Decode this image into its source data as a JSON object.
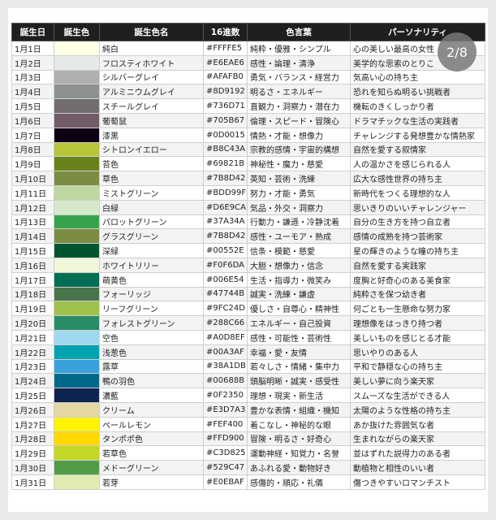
{
  "headers": [
    "誕生日",
    "誕生色",
    "誕生色名",
    "16進数",
    "色言葉",
    "パーソナリティ"
  ],
  "page_indicator": "2/8",
  "rows": [
    {
      "date": "1月1日",
      "color": "#FFFFE5",
      "name": "純白",
      "hex": "#FFFFE5",
      "words": "純粋・優雅・シンプル",
      "personality": "心の美しい最高の女性"
    },
    {
      "date": "1月2日",
      "color": "#E6EAE6",
      "name": "フロスティホワイト",
      "hex": "#E6EAE6",
      "words": "感性・論理・清浄",
      "personality": "美学的な思索のとりこ"
    },
    {
      "date": "1月3日",
      "color": "#AFAFB0",
      "name": "シルバーグレイ",
      "hex": "#AFAFB0",
      "words": "勇気・バランス・経営力",
      "personality": "気高い心の持ち主"
    },
    {
      "date": "1月4日",
      "color": "#8D9192",
      "name": "アルミニウムグレイ",
      "hex": "#8D9192",
      "words": "明るさ・エネルギー",
      "personality": "恐れを知らぬ明るい挑戦者"
    },
    {
      "date": "1月5日",
      "color": "#736D71",
      "name": "スチールグレイ",
      "hex": "#736D71",
      "words": "直観力・洞察力・潜在力",
      "personality": "機転のきくしっかり者"
    },
    {
      "date": "1月6日",
      "color": "#705B67",
      "name": "葡萄鼠",
      "hex": "#705B67",
      "words": "倫理・スピード・冒険心",
      "personality": "ドラマチックな生活の実践者"
    },
    {
      "date": "1月7日",
      "color": "#0D0015",
      "name": "漆黒",
      "hex": "#0D0015",
      "words": "情熱・才能・想像力",
      "personality": "チャレンジする発想豊かな情熱家"
    },
    {
      "date": "1月8日",
      "color": "#B8C43A",
      "name": "シトロンイエロー",
      "hex": "#B8C43A",
      "words": "宗教的感情・宇宙的構想",
      "personality": "自然を愛する叙情家"
    },
    {
      "date": "1月9日",
      "color": "#69821B",
      "name": "苔色",
      "hex": "#69821B",
      "words": "神秘性・魔力・慈愛",
      "personality": "人の温かさを感じられる人"
    },
    {
      "date": "1月10日",
      "color": "#7B8D42",
      "name": "草色",
      "hex": "#7B8D42",
      "words": "英知・芸術・洗練",
      "personality": "広大な感性世界の持ち主"
    },
    {
      "date": "1月11日",
      "color": "#BDD99F",
      "name": "ミストグリーン",
      "hex": "#BDD99F",
      "words": "努力・才能・勇気",
      "personality": "新時代をつくる理想的な人"
    },
    {
      "date": "1月12日",
      "color": "#D6E9CA",
      "name": "白緑",
      "hex": "#D6E9CA",
      "words": "気品・外交・洞察力",
      "personality": "思いきりのいいチャレンジャー"
    },
    {
      "date": "1月13日",
      "color": "#37A34A",
      "name": "パロットグリーン",
      "hex": "#37A34A",
      "words": "行動力・謙遜・冷静沈着",
      "personality": "自分の生き方を持つ自立者"
    },
    {
      "date": "1月14日",
      "color": "#7B8D42",
      "name": "グラスグリーン",
      "hex": "#7B8D42",
      "words": "感性・ユーモア・熟成",
      "personality": "感情の成熟を持つ芸術家"
    },
    {
      "date": "1月15日",
      "color": "#00552E",
      "name": "深緑",
      "hex": "#00552E",
      "words": "信条・模範・慈愛",
      "personality": "星の輝きのような瞳の持ち主"
    },
    {
      "date": "1月16日",
      "color": "#F0F6DA",
      "name": "ホワイトリリー",
      "hex": "#F0F6DA",
      "words": "大胆・想像力・信念",
      "personality": "自然を愛する実践家"
    },
    {
      "date": "1月17日",
      "color": "#006E54",
      "name": "萌黄色",
      "hex": "#006E54",
      "words": "生活・指導力・微笑み",
      "personality": "度胸と好奇心のある美食家"
    },
    {
      "date": "1月18日",
      "color": "#47744B",
      "name": "フォーリッジ",
      "hex": "#47744B",
      "words": "誠実・洗練・謙虚",
      "personality": "純粋さを保つ幼き者"
    },
    {
      "date": "1月19日",
      "color": "#9FC24D",
      "name": "リーフグリーン",
      "hex": "#9FC24D",
      "words": "優しさ・自尊心・精神性",
      "personality": "何ごとも一生懸命な努力家"
    },
    {
      "date": "1月20日",
      "color": "#288C66",
      "name": "フォレストグリーン",
      "hex": "#288C66",
      "words": "エネルギー・自己投資",
      "personality": "理想像をはっきり持つ者"
    },
    {
      "date": "1月21日",
      "color": "#A0D8EF",
      "name": "空色",
      "hex": "#A0D8EF",
      "words": "感性・可能性・芸術性",
      "personality": "美しいものを感じとる才能"
    },
    {
      "date": "1月22日",
      "color": "#00A3AF",
      "name": "浅葱色",
      "hex": "#00A3AF",
      "words": "幸福・愛・友情",
      "personality": "思いやりのある人"
    },
    {
      "date": "1月23日",
      "color": "#38A1DB",
      "name": "露草",
      "hex": "#38A1DB",
      "words": "若々しさ・情緒・集中力",
      "personality": "平和で静穏な心の持ち主"
    },
    {
      "date": "1月24日",
      "color": "#00688B",
      "name": "鴨の羽色",
      "hex": "#00688B",
      "words": "頭脳明晰・誠実・感受性",
      "personality": "美しい夢に向う楽天家"
    },
    {
      "date": "1月25日",
      "color": "#0F2350",
      "name": "濃藍",
      "hex": "#0F2350",
      "words": "理想・現実・新生活",
      "personality": "スムーズな生活ができる人"
    },
    {
      "date": "1月26日",
      "color": "#E3D7A3",
      "name": "クリーム",
      "hex": "#E3D7A3",
      "words": "豊かな表情・組織・機知",
      "personality": "太陽のような性格の持ち主"
    },
    {
      "date": "1月27日",
      "color": "#FEF400",
      "name": "ペールレモン",
      "hex": "#FEF400",
      "words": "着こなし・神秘的な眼",
      "personality": "あか抜けた雰囲気な者"
    },
    {
      "date": "1月28日",
      "color": "#FFD900",
      "name": "タンポポ色",
      "hex": "#FFD900",
      "words": "冒険・明るさ・好奇心",
      "personality": "生まれながらの楽天家"
    },
    {
      "date": "1月29日",
      "color": "#C3D825",
      "name": "若草色",
      "hex": "#C3D825",
      "words": "運動神経・知覚力・名誉",
      "personality": "並はずれた説得力のある者"
    },
    {
      "date": "1月30日",
      "color": "#529C47",
      "name": "メドーグリーン",
      "hex": "#529C47",
      "words": "あふれる愛・動物好き",
      "personality": "動植物と相性のいい者"
    },
    {
      "date": "1月31日",
      "color": "#E0EBAF",
      "name": "若芽",
      "hex": "#E0EBAF",
      "words": "感傷的・順応・礼儀",
      "personality": "傷つきやすいロマンチスト"
    }
  ]
}
